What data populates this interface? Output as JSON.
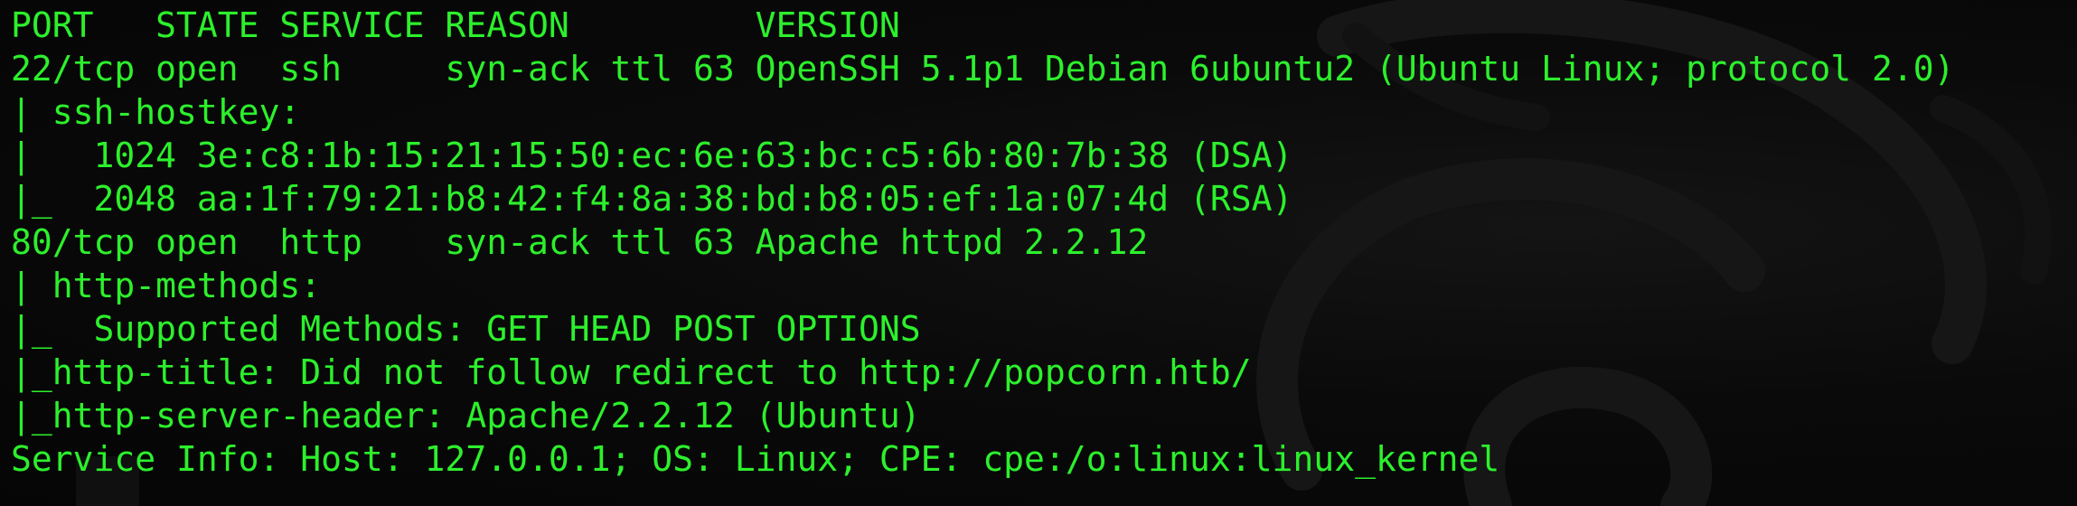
{
  "terminal": {
    "colors": {
      "background": "#050505",
      "text": "#2cf02c"
    },
    "watermark_icon": "kali-dragon-icon",
    "lines": [
      "PORT   STATE SERVICE REASON         VERSION",
      "22/tcp open  ssh     syn-ack ttl 63 OpenSSH 5.1p1 Debian 6ubuntu2 (Ubuntu Linux; protocol 2.0)",
      "| ssh-hostkey:",
      "|   1024 3e:c8:1b:15:21:15:50:ec:6e:63:bc:c5:6b:80:7b:38 (DSA)",
      "|_  2048 aa:1f:79:21:b8:42:f4:8a:38:bd:b8:05:ef:1a:07:4d (RSA)",
      "80/tcp open  http    syn-ack ttl 63 Apache httpd 2.2.12",
      "| http-methods:",
      "|_  Supported Methods: GET HEAD POST OPTIONS",
      "|_http-title: Did not follow redirect to http://popcorn.htb/",
      "|_http-server-header: Apache/2.2.12 (Ubuntu)",
      "Service Info: Host: 127.0.0.1; OS: Linux; CPE: cpe:/o:linux:linux_kernel"
    ]
  }
}
